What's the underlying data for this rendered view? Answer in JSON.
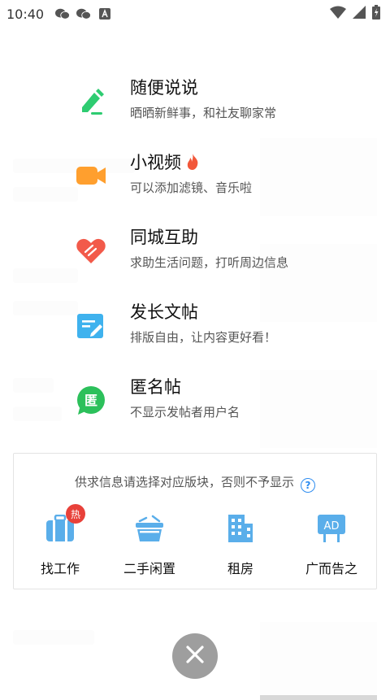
{
  "status_bar": {
    "time": "10:40"
  },
  "menu_items": [
    {
      "title": "随便说说",
      "subtitle": "晒晒新鲜事，和社友聊家常"
    },
    {
      "title": "小视频",
      "subtitle": "可以添加滤镜、音乐啦"
    },
    {
      "title": "同城互助",
      "subtitle": "求助生活问题，打听周边信息"
    },
    {
      "title": "发长文帖",
      "subtitle": "排版自由，让内容更好看！"
    },
    {
      "title": "匿名帖",
      "subtitle": "不显示发帖者用户名"
    }
  ],
  "anonymous_icon_char": "匿",
  "category_card": {
    "notice": "供求信息请选择对应版块，否则不予显示",
    "help_symbol": "?",
    "categories": [
      {
        "label": "找工作",
        "badge": "热"
      },
      {
        "label": "二手闲置"
      },
      {
        "label": "租房"
      },
      {
        "label": "广而告之",
        "icon_text": "AD"
      }
    ]
  },
  "colors": {
    "pencil_green": "#2ecc71",
    "video_orange": "#ff9f2e",
    "heart_red": "#f25a4a",
    "article_blue": "#3fb2ee",
    "anon_green": "#2cc05b",
    "category_blue": "#5aaeea",
    "badge_red": "#e8413a"
  }
}
